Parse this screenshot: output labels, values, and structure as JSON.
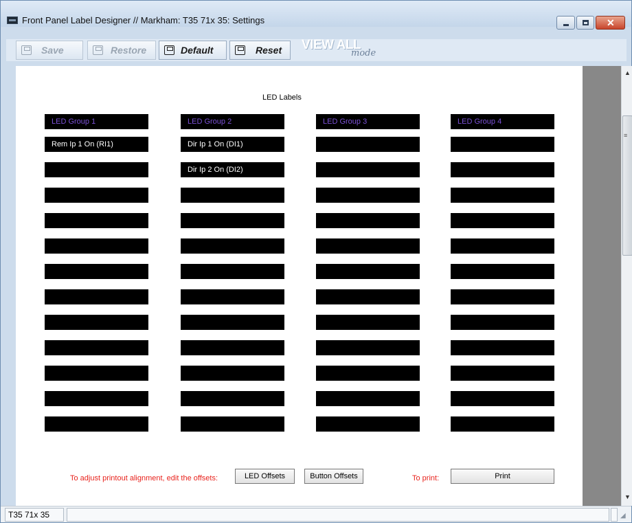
{
  "window": {
    "title": "Front Panel Label Designer // Markham: T35 71x 35: Settings",
    "close_glyph": "✕"
  },
  "toolbar": {
    "save_label": "Save",
    "restore_label": "Restore",
    "default_label": "Default",
    "reset_label": "Reset",
    "view_all_label": "VIEW ALL",
    "view_mode_label": "mode"
  },
  "content": {
    "section_title": "LED Labels",
    "groups": [
      {
        "header": "LED Group 1",
        "labels": [
          "Rem Ip 1 On (RI1)",
          "",
          "",
          "",
          "",
          "",
          "",
          "",
          "",
          "",
          "",
          ""
        ]
      },
      {
        "header": "LED Group 2",
        "labels": [
          "Dir Ip 1 On (DI1)",
          "Dir Ip 2 On (DI2)",
          "",
          "",
          "",
          "",
          "",
          "",
          "",
          "",
          "",
          ""
        ]
      },
      {
        "header": "LED Group 3",
        "labels": [
          "",
          "",
          "",
          "",
          "",
          "",
          "",
          "",
          "",
          "",
          "",
          ""
        ]
      },
      {
        "header": "LED Group 4",
        "labels": [
          "",
          "",
          "",
          "",
          "",
          "",
          "",
          "",
          "",
          "",
          "",
          ""
        ]
      }
    ],
    "offset_hint": "To adjust printout alignment, edit the offsets:",
    "led_offsets_label": "LED Offsets",
    "button_offsets_label": "Button Offsets",
    "print_hint": "To print:",
    "print_label": "Print"
  },
  "statusbar": {
    "device": "T35 71x 35"
  },
  "colors": {
    "led_cell_bg": "#000000",
    "group_header_text": "#7c52d8",
    "hint_text": "#e8221c",
    "side_gutter": "#888888"
  }
}
